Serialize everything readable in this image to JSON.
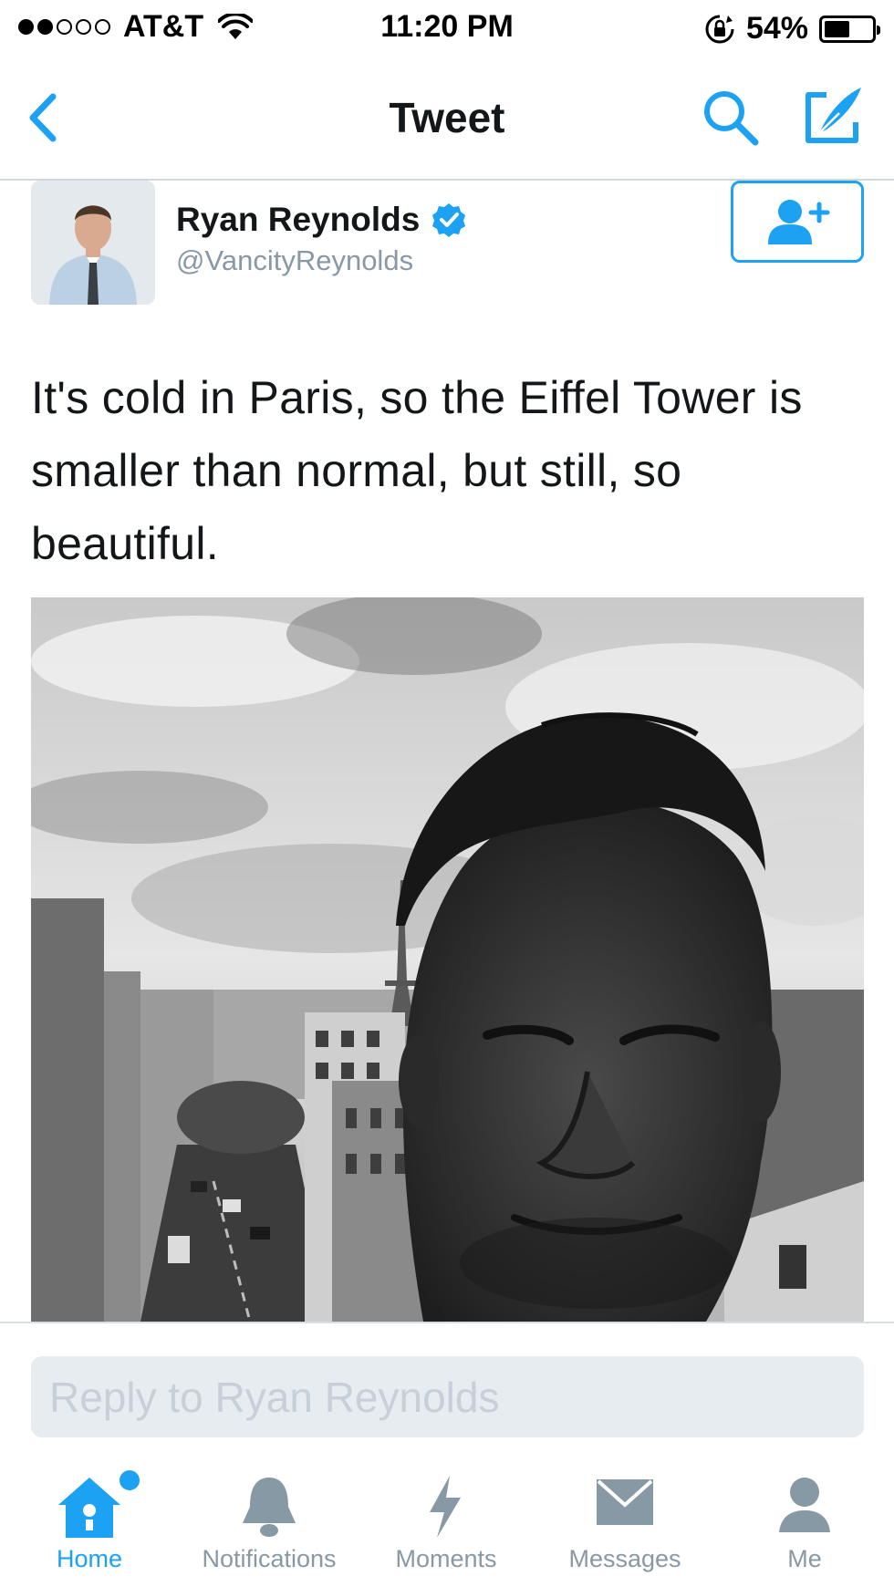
{
  "status_bar": {
    "carrier": "AT&T",
    "time": "11:20 PM",
    "battery_percent_label": "54%",
    "battery_level": 0.54,
    "signal_bars": 2
  },
  "nav": {
    "title": "Tweet"
  },
  "tweet": {
    "author_name": "Ryan Reynolds",
    "author_handle": "@VancityReynolds",
    "verified": true,
    "text": "It's cold in Paris, so the Eiffel Tower is smaller than normal, but still, so beautiful."
  },
  "reply": {
    "placeholder": "Reply to Ryan Reynolds"
  },
  "tabs": [
    {
      "label": "Home",
      "icon": "home-icon",
      "active": true,
      "has_notification_dot": true
    },
    {
      "label": "Notifications",
      "icon": "bell-icon",
      "active": false
    },
    {
      "label": "Moments",
      "icon": "lightning-icon",
      "active": false
    },
    {
      "label": "Messages",
      "icon": "envelope-icon",
      "active": false
    },
    {
      "label": "Me",
      "icon": "person-icon",
      "active": false
    }
  ],
  "colors": {
    "accent": "#1da1f2",
    "inactive_icon": "#8899a6",
    "text_primary": "#14171a",
    "reply_box_bg": "#e7ecf0"
  }
}
